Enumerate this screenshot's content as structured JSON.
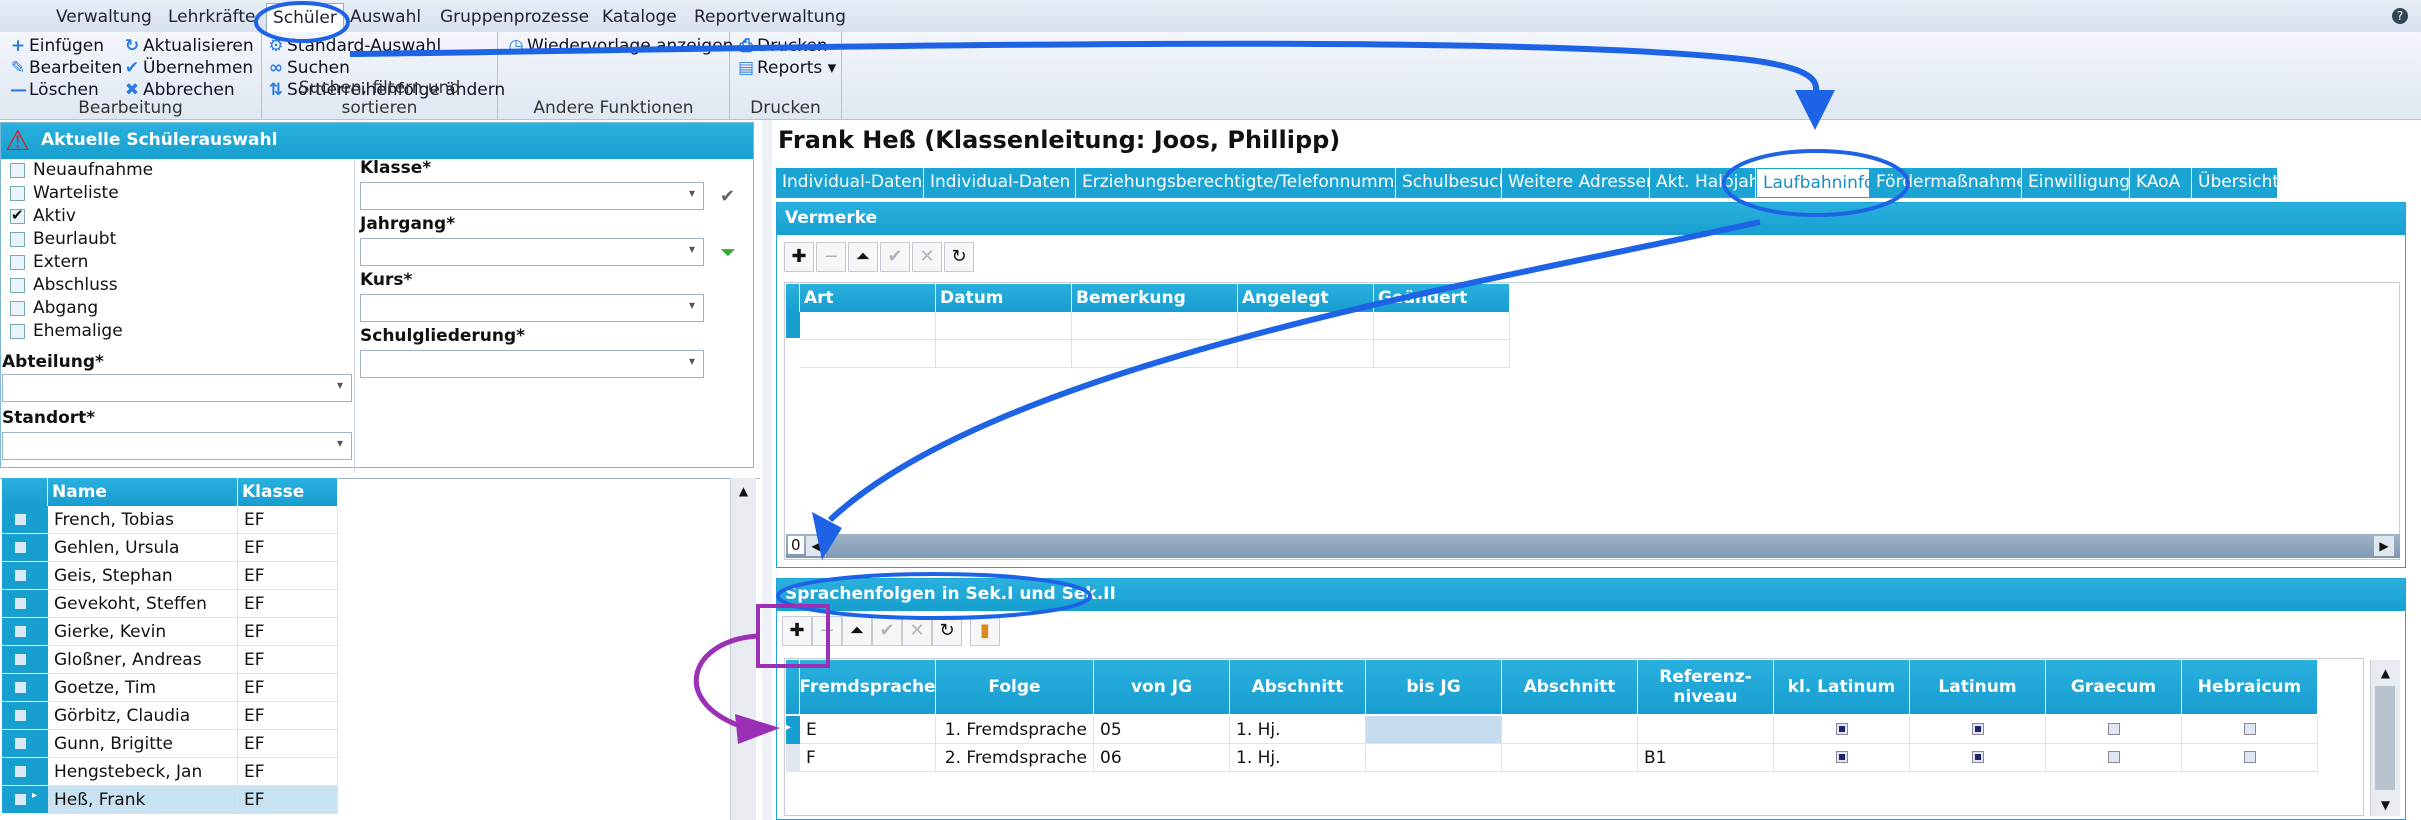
{
  "menubar": {
    "items": [
      "Verwaltung",
      "Lehrkräfte",
      "Schüler",
      "Auswahl",
      "Gruppenprozesse",
      "Kataloge",
      "Reportverwaltung"
    ],
    "help": "?"
  },
  "ribbon": {
    "bearbeitung": {
      "label": "Bearbeitung",
      "buttons": [
        "Einfügen",
        "Bearbeiten",
        "Löschen",
        "Aktualisieren",
        "Übernehmen",
        "Abbrechen"
      ]
    },
    "suchen": {
      "label": "Suchen, filtern und sortieren",
      "buttons": [
        "Standard-Auswahl",
        "Suchen",
        "Sortierreihenfolge ändern"
      ]
    },
    "andere": {
      "label": "Andere Funktionen",
      "buttons": [
        "Wiedervorlage anzeigen"
      ]
    },
    "drucken": {
      "label": "Drucken",
      "buttons": [
        "Drucken",
        "Reports"
      ]
    }
  },
  "selection": {
    "title": "Aktuelle Schülerauswahl",
    "statuses": [
      {
        "label": "Neuaufnahme",
        "checked": false
      },
      {
        "label": "Warteliste",
        "checked": false
      },
      {
        "label": "Aktiv",
        "checked": true
      },
      {
        "label": "Beurlaubt",
        "checked": false
      },
      {
        "label": "Extern",
        "checked": false
      },
      {
        "label": "Abschluss",
        "checked": false
      },
      {
        "label": "Abgang",
        "checked": false
      },
      {
        "label": "Ehemalige",
        "checked": false
      }
    ],
    "klasse": "Klasse*",
    "jahrgang": "Jahrgang*",
    "kurs": "Kurs*",
    "schulgliederung": "Schulgliederung*",
    "abteilung": "Abteilung*",
    "standort": "Standort*"
  },
  "students": {
    "headers": [
      "Name",
      "Klasse"
    ],
    "rows": [
      {
        "name": "French, Tobias",
        "klasse": "EF"
      },
      {
        "name": "Gehlen, Ursula",
        "klasse": "EF"
      },
      {
        "name": "Geis, Stephan",
        "klasse": "EF"
      },
      {
        "name": "Gevekoht, Steffen",
        "klasse": "EF"
      },
      {
        "name": "Gierke, Kevin",
        "klasse": "EF"
      },
      {
        "name": "Gloßner, Andreas",
        "klasse": "EF"
      },
      {
        "name": "Goetze, Tim",
        "klasse": "EF"
      },
      {
        "name": "Görbitz, Claudia",
        "klasse": "EF"
      },
      {
        "name": "Gunn, Brigitte",
        "klasse": "EF"
      },
      {
        "name": "Hengstebeck, Jan",
        "klasse": "EF"
      },
      {
        "name": "Heß, Frank",
        "klasse": "EF"
      }
    ]
  },
  "detail": {
    "title": "Frank Heß (Klassenleitung: Joos, Phillipp)",
    "tabs": [
      "Individual-Daten I",
      "Individual-Daten II",
      "Erziehungsberechtigte/Telefonnummern",
      "Schulbesuch",
      "Weitere Adressen",
      "Akt. Halbjahr",
      "Laufbahninfo",
      "Fördermaßnahmen",
      "Einwilligung",
      "KAoA",
      "Übersicht"
    ],
    "active_tab": "Laufbahninfo",
    "vermerke": {
      "title": "Vermerke",
      "headers": [
        "Art",
        "Datum",
        "Bemerkung",
        "Angelegt von",
        "Geändert von"
      ],
      "count": "0"
    },
    "sprachen": {
      "title": "Sprachenfolgen in Sek.I und Sek.II",
      "headers": [
        "Fremdsprache",
        "Folge",
        "von JG",
        "Abschnitt",
        "bis JG",
        "Abschnitt",
        "Referenz-\nniveau",
        "kl. Latinum",
        "Latinum",
        "Graecum",
        "Hebraicum"
      ],
      "rows": [
        {
          "fremdsprache": "E",
          "folge": "1. Fremdsprache",
          "von_jg": "05",
          "abschnitt": "1. Hj.",
          "bis_jg": "",
          "abschnitt2": "",
          "ref": "",
          "kl_latinum": true,
          "latinum": true,
          "graecum": false,
          "hebraicum": false
        },
        {
          "fremdsprache": "F",
          "folge": "2. Fremdsprache",
          "von_jg": "06",
          "abschnitt": "1. Hj.",
          "bis_jg": "",
          "abschnitt2": "",
          "ref": "B1",
          "kl_latinum": true,
          "latinum": true,
          "graecum": false,
          "hebraicum": false
        }
      ]
    }
  },
  "colors": {
    "accent": "#1aa4d4",
    "annotation_blue": "#1e63e6",
    "annotation_purple": "#9b2fb5"
  }
}
